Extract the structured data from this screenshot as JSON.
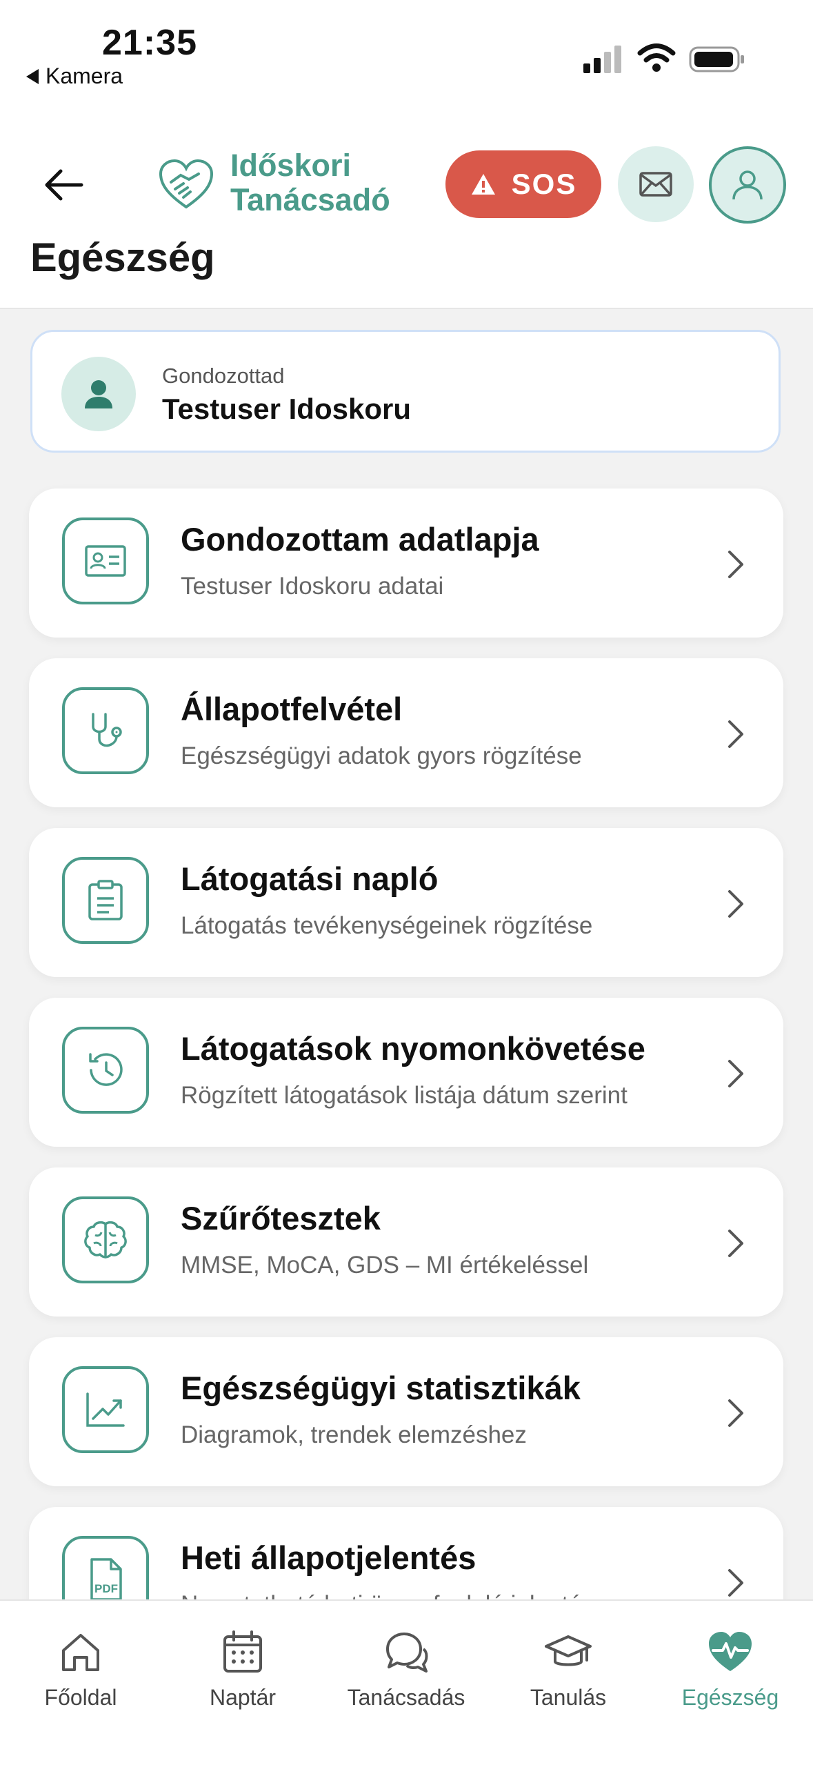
{
  "status_bar": {
    "time": "21:35",
    "back_app": "Kamera"
  },
  "header": {
    "logo_line1": "Időskori",
    "logo_line2": "Tanácsadó",
    "sos_label": "SOS",
    "page_title": "Egészség"
  },
  "patient": {
    "label": "Gondozottad",
    "name": "Testuser Idoskoru"
  },
  "menu": [
    {
      "title": "Gondozottam adatlapja",
      "subtitle": "Testuser Idoskoru adatai",
      "icon": "id-card-icon"
    },
    {
      "title": "Állapotfelvétel",
      "subtitle": "Egészségügyi adatok gyors rögzítése",
      "icon": "stethoscope-icon"
    },
    {
      "title": "Látogatási napló",
      "subtitle": "Látogatás tevékenységeinek rögzítése",
      "icon": "clipboard-icon"
    },
    {
      "title": "Látogatások nyomonkövetése",
      "subtitle": "Rögzített látogatások listája dátum szerint",
      "icon": "history-icon"
    },
    {
      "title": "Szűrőtesztek",
      "subtitle": "MMSE, MoCA, GDS – MI értékeléssel",
      "icon": "brain-icon"
    },
    {
      "title": "Egészségügyi statisztikák",
      "subtitle": "Diagramok, trendek elemzéshez",
      "icon": "trend-chart-icon"
    },
    {
      "title": "Heti állapotjelentés",
      "subtitle": "Nyomtatható heti összefoglaló jelentés",
      "icon": "pdf-file-icon"
    }
  ],
  "tabs": [
    {
      "label": "Főoldal",
      "icon": "home-icon"
    },
    {
      "label": "Naptár",
      "icon": "calendar-icon"
    },
    {
      "label": "Tanácsadás",
      "icon": "chat-icon"
    },
    {
      "label": "Tanulás",
      "icon": "graduation-cap-icon"
    },
    {
      "label": "Egészség",
      "icon": "heart-pulse-icon",
      "active": true
    }
  ],
  "colors": {
    "accent": "#4a9b8a",
    "sos": "#d9584a",
    "accent_light": "#dcefeb"
  }
}
